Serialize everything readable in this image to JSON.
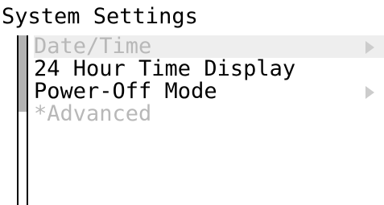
{
  "window": {
    "title": "System Settings"
  },
  "menu": {
    "items": [
      {
        "label": "Date/Time",
        "enabled": false,
        "selected": true,
        "has_submenu": true
      },
      {
        "label": "24 Hour Time Display",
        "enabled": true,
        "selected": false,
        "has_submenu": false
      },
      {
        "label": "Power-Off Mode",
        "enabled": true,
        "selected": false,
        "has_submenu": true
      },
      {
        "label": "*Advanced",
        "enabled": false,
        "selected": false,
        "has_submenu": false
      }
    ]
  },
  "scrollbar": {
    "visible_fraction": 0.45
  },
  "colors": {
    "enabled_text": "#000000",
    "disabled_text": "#b8b8b8",
    "selection_bg": "#eeeeee",
    "arrow": "#cccccc",
    "scroll_thumb": "#b3b3b3"
  },
  "icons": {
    "submenu": "chevron-right-icon"
  }
}
